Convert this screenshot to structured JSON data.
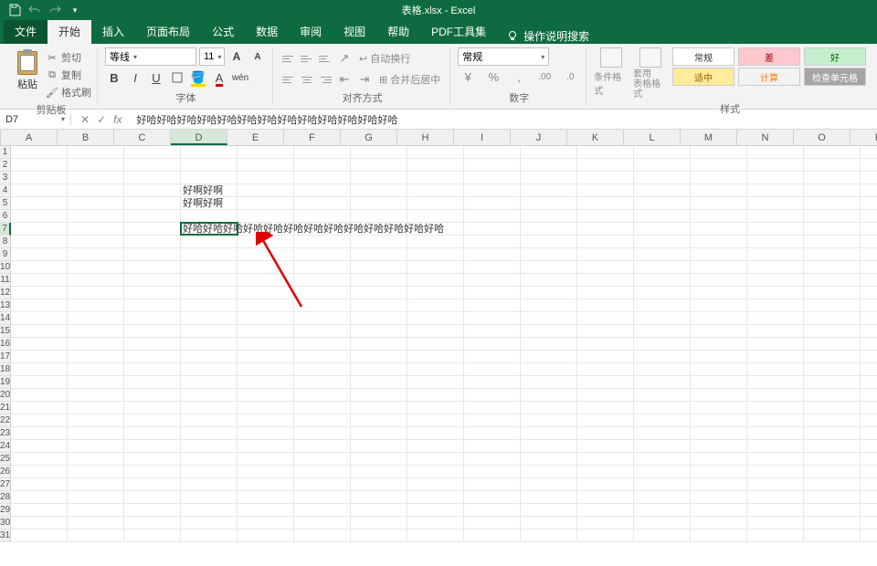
{
  "titlebar": {
    "title": "表格.xlsx  -  Excel"
  },
  "tabs": {
    "file": "文件",
    "home": "开始",
    "insert": "插入",
    "layout": "页面布局",
    "formula": "公式",
    "data": "数据",
    "review": "审阅",
    "view": "视图",
    "help": "帮助",
    "pdf": "PDF工具集",
    "tell_me": "操作说明搜索"
  },
  "ribbon": {
    "clipboard": {
      "paste": "粘贴",
      "cut": "剪切",
      "copy": "复制",
      "format_painter": "格式刷",
      "label": "剪贴板"
    },
    "font": {
      "name": "等线",
      "size": "11",
      "label": "字体"
    },
    "alignment": {
      "wrap": "自动换行",
      "merge": "合并后居中",
      "label": "对齐方式"
    },
    "number": {
      "format": "常规",
      "label": "数字"
    },
    "styles": {
      "conditional": "条件格式",
      "table_format": "套用\n表格格式",
      "normal": "常规",
      "bad": "差",
      "good": "好",
      "neutral": "适中",
      "calc": "计算",
      "check": "检查单元格",
      "label": "样式"
    }
  },
  "formula_bar": {
    "name_box": "D7",
    "fx": "fx",
    "content": "好哈好哈好哈好哈好哈好哈好哈好哈好哈好哈好哈好哈好哈"
  },
  "columns": [
    "A",
    "B",
    "C",
    "D",
    "E",
    "F",
    "G",
    "H",
    "I",
    "J",
    "K",
    "L",
    "M",
    "N",
    "O",
    "P"
  ],
  "row_count": 31,
  "active_col": "D",
  "active_row": 7,
  "cells": {
    "D4": "好啊好啊",
    "D5": "好啊好啊",
    "D7": "好哈好哈好哈好哈好哈好哈好哈好哈好哈好哈好哈好哈好哈"
  }
}
